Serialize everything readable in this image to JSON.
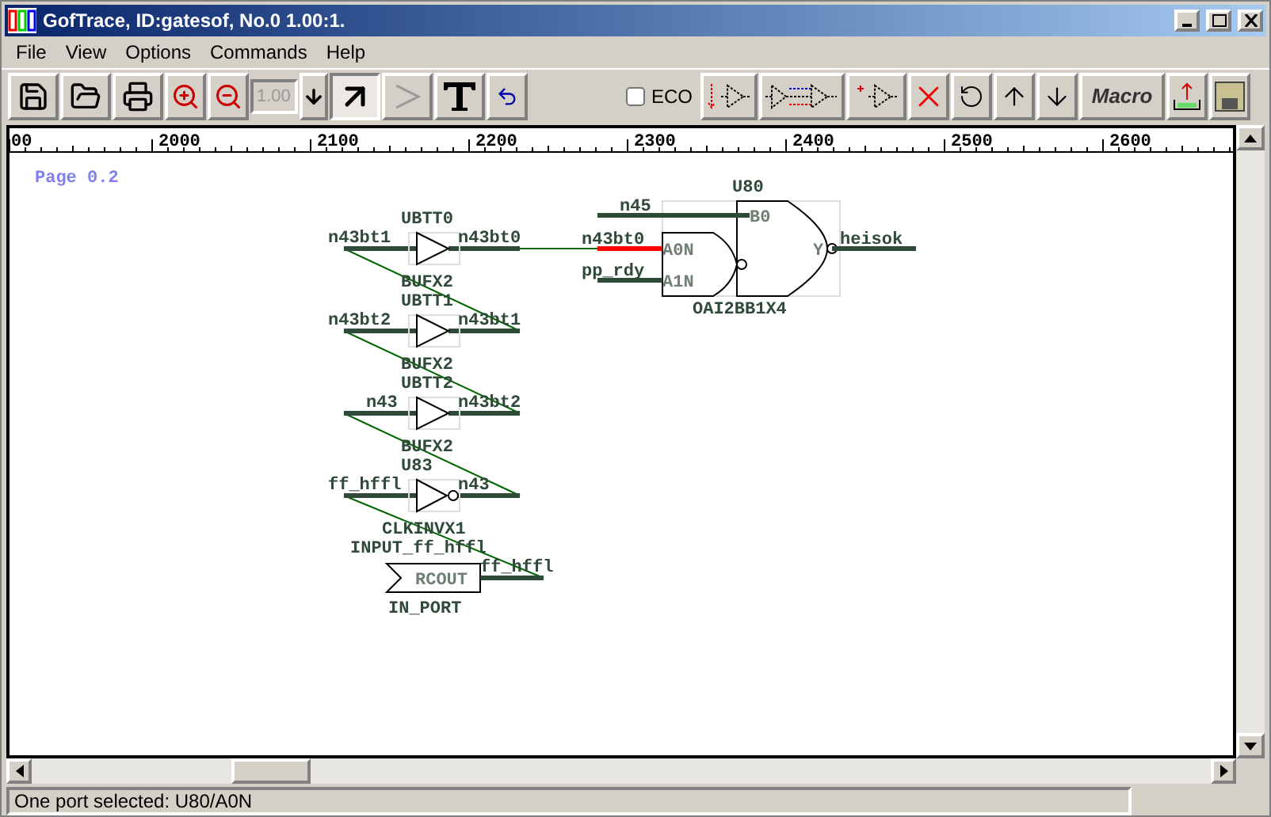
{
  "window": {
    "title": "GofTrace, ID:gatesof, No.0 1.00:1."
  },
  "menu": [
    "File",
    "View",
    "Options",
    "Commands",
    "Help"
  ],
  "toolbar": {
    "tools": [
      {
        "kind": "pointer",
        "selected": true
      },
      {
        "kind": "buffer",
        "selected": false
      }
    ],
    "zoom_field": {
      "value": "1.00",
      "disabled": true
    },
    "eco": {
      "label": "ECO",
      "checked": false
    },
    "macro": "Macro"
  },
  "ruler": [
    "00",
    "2000",
    "2100",
    "2200",
    "2300",
    "2400",
    "2500",
    "2600"
  ],
  "schematic": {
    "page_label": "Page 0.2",
    "instances": [
      {
        "kind": "buffer",
        "name": "UBTT0",
        "cell": "BUFX2",
        "input": "n43bt1",
        "output": "n43bt0"
      },
      {
        "kind": "buffer",
        "name": "UBTT1",
        "cell": "BUFX2",
        "input": "n43bt2",
        "output": "n43bt1"
      },
      {
        "kind": "buffer",
        "name": "UBTT2",
        "cell": "BUFX2",
        "input": "n43",
        "output": "n43bt2"
      },
      {
        "kind": "inverter",
        "name": "U83",
        "cell": "CLKINVX1",
        "input": "ff_hffl",
        "output": "n43"
      },
      {
        "kind": "port",
        "name": "INPUT_ff_hffl",
        "cell": "IN_PORT",
        "pin": "RCOUT",
        "output": "ff_hffl"
      },
      {
        "kind": "oai",
        "name": "U80",
        "cell": "OAI2BB1X4",
        "pins": [
          {
            "name": "B0",
            "net": "n45",
            "selected": false
          },
          {
            "name": "A0N",
            "net": "n43bt0",
            "selected": true
          },
          {
            "name": "A1N",
            "net": "pp_rdy",
            "selected": false
          },
          {
            "name": "Y",
            "net": "heisok",
            "selected": false
          }
        ]
      }
    ]
  },
  "status_bar": "One port selected: U80/A0N"
}
